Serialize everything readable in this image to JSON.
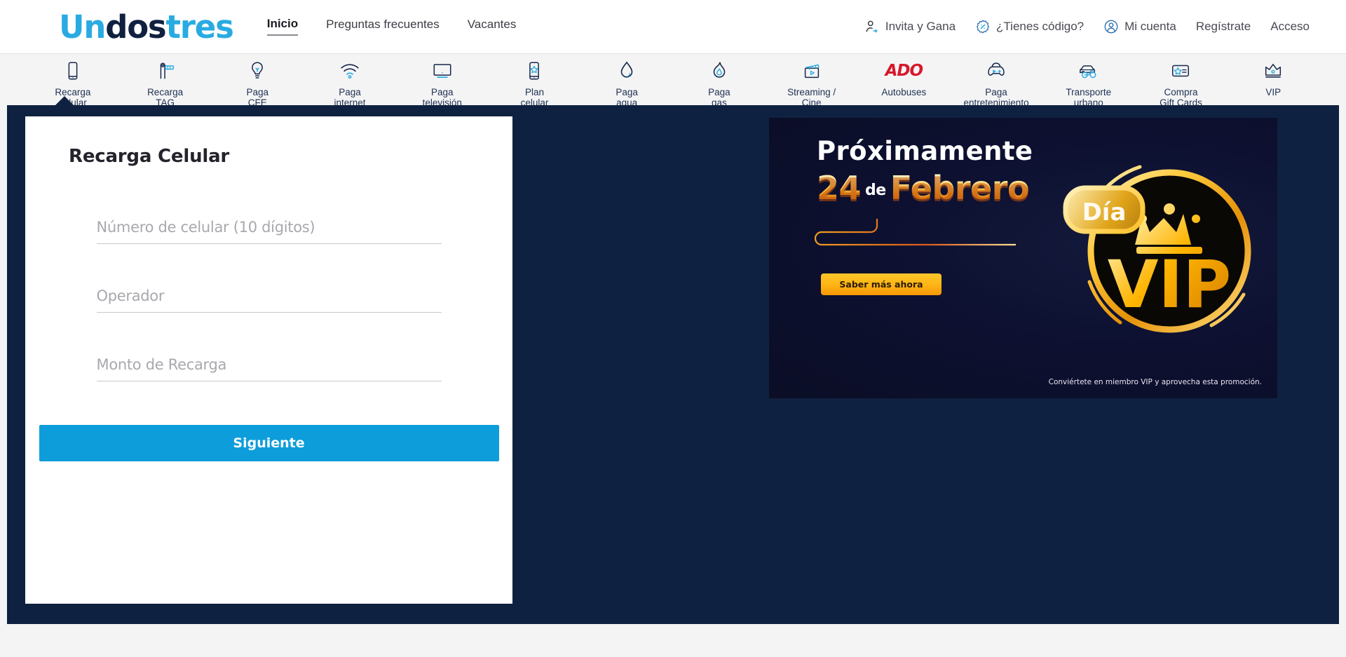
{
  "header": {
    "logo": {
      "part1": "Un",
      "part2": "dos",
      "part3": "tres"
    },
    "nav": [
      {
        "label": "Inicio",
        "active": true
      },
      {
        "label": "Preguntas frecuentes",
        "active": false
      },
      {
        "label": "Vacantes",
        "active": false
      }
    ],
    "user_nav": [
      {
        "label": "Invita y Gana",
        "icon": "user-share-icon"
      },
      {
        "label": "¿Tienes código?",
        "icon": "discount-badge-icon"
      },
      {
        "label": "Mi cuenta",
        "icon": "user-circle-icon"
      },
      {
        "label": "Regístrate",
        "icon": ""
      },
      {
        "label": "Acceso",
        "icon": ""
      }
    ]
  },
  "icon_nav": {
    "active_index": 0,
    "items": [
      {
        "label": "Recarga\ncelular",
        "icon": "smartphone-icon"
      },
      {
        "label": "Recarga\nTAG",
        "icon": "toll-barrier-icon"
      },
      {
        "label": "Paga\nCFE",
        "icon": "lightbulb-icon"
      },
      {
        "label": "Paga\ninternet",
        "icon": "wifi-icon"
      },
      {
        "label": "Paga\ntelevisión",
        "icon": "tv-monitor-icon"
      },
      {
        "label": "Plan\ncelular",
        "icon": "phone-star-icon"
      },
      {
        "label": "Paga\nagua",
        "icon": "water-drop-icon"
      },
      {
        "label": "Paga\ngas",
        "icon": "flame-icon"
      },
      {
        "label": "Streaming /\nCine",
        "icon": "clapperboard-icon"
      },
      {
        "label": "Autobuses",
        "icon": "ado-logo-icon",
        "logo_text": "ADO"
      },
      {
        "label": "Paga\nentretenimiento",
        "icon": "gamepad-icon"
      },
      {
        "label": "Transporte\nurbano",
        "icon": "car-bike-icon"
      },
      {
        "label": "Compra\nGift Cards",
        "icon": "gift-card-icon"
      },
      {
        "label": "VIP",
        "icon": "crown-icon"
      }
    ]
  },
  "form": {
    "title": "Recarga Celular",
    "fields": [
      {
        "name": "phone",
        "placeholder": "Número de celular (10 dígitos)",
        "value": ""
      },
      {
        "name": "operator",
        "placeholder": "Operador",
        "value": ""
      },
      {
        "name": "amount",
        "placeholder": "Monto de Recarga",
        "value": ""
      }
    ],
    "submit_label": "Siguiente"
  },
  "banner": {
    "headline": "Próximamente",
    "date_number": "24",
    "date_conn": "de",
    "date_month": "Febrero",
    "cta_label": "Saber más ahora",
    "footnote": "Conviértete en miembro VIP y aprovecha esta promoción.",
    "badge_tag": "Día",
    "badge_title": "VIP"
  },
  "colors": {
    "brand_blue": "#29abe2",
    "brand_navy": "#10203f",
    "panel_navy": "#0f2140",
    "button_blue": "#0d9ddb",
    "ado_red": "#d7182a",
    "gold": "#fdb515",
    "page_bg": "#f4f4f5"
  }
}
